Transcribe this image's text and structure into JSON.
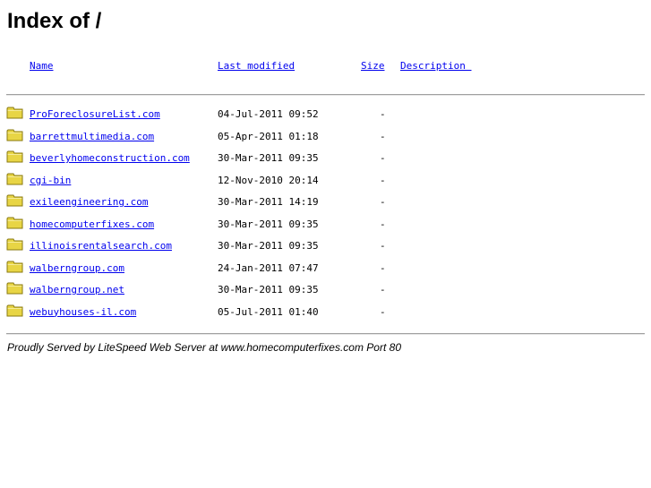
{
  "page": {
    "heading": "Index of /"
  },
  "columns": {
    "name": "Name",
    "last_modified": "Last modified",
    "size": "Size",
    "description": "Description "
  },
  "entries": [
    {
      "name": "ProForeclosureList.com",
      "modified": "04-Jul-2011 09:52",
      "size": "-",
      "icon": "folder-icon"
    },
    {
      "name": "barrettmultimedia.com",
      "modified": "05-Apr-2011 01:18",
      "size": "-",
      "icon": "folder-icon"
    },
    {
      "name": "beverlyhomeconstruction.com",
      "modified": "30-Mar-2011 09:35",
      "size": "-",
      "icon": "folder-icon"
    },
    {
      "name": "cgi-bin",
      "modified": "12-Nov-2010 20:14",
      "size": "-",
      "icon": "folder-icon"
    },
    {
      "name": "exileengineering.com",
      "modified": "30-Mar-2011 14:19",
      "size": "-",
      "icon": "folder-icon"
    },
    {
      "name": "homecomputerfixes.com",
      "modified": "30-Mar-2011 09:35",
      "size": "-",
      "icon": "folder-icon"
    },
    {
      "name": "illinoisrentalsearch.com",
      "modified": "30-Mar-2011 09:35",
      "size": "-",
      "icon": "folder-icon"
    },
    {
      "name": "walberngroup.com",
      "modified": "24-Jan-2011 07:47",
      "size": "-",
      "icon": "folder-icon"
    },
    {
      "name": "walberngroup.net",
      "modified": "30-Mar-2011 09:35",
      "size": "-",
      "icon": "folder-icon"
    },
    {
      "name": "webuyhouses-il.com",
      "modified": "05-Jul-2011 01:40",
      "size": "-",
      "icon": "folder-icon"
    }
  ],
  "footer": {
    "text": "Proudly Served by LiteSpeed Web Server at www.homecomputerfixes.com Port 80"
  },
  "colors": {
    "link": "#0000ee",
    "folder_fill": "#e8d545",
    "folder_edge": "#8a7a10",
    "rule": "#a0a0a0"
  }
}
